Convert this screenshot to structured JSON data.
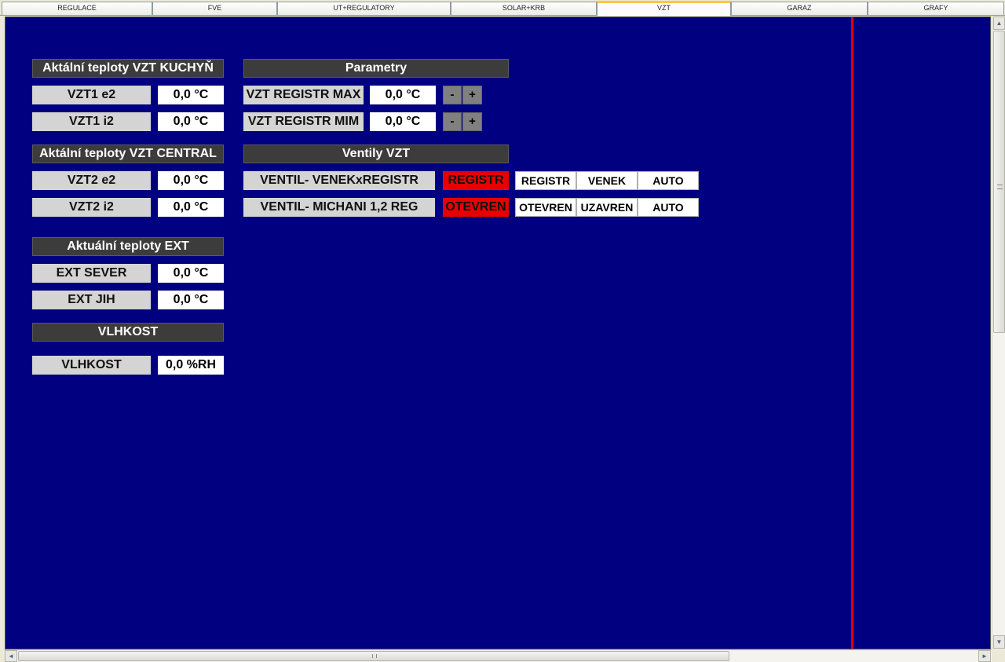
{
  "tabs": [
    {
      "label": "REGULACE"
    },
    {
      "label": "FVE"
    },
    {
      "label": "UT+REGULATORY"
    },
    {
      "label": "SOLAR+KRB"
    },
    {
      "label": "VZT"
    },
    {
      "label": "GARAZ"
    },
    {
      "label": "GRAFY"
    }
  ],
  "active_tab": "VZT",
  "kuchyn": {
    "title": "Aktální teploty VZT KUCHYŇ",
    "rows": [
      {
        "label": "VZT1 e2",
        "value": "0,0 °C"
      },
      {
        "label": "VZT1 i2",
        "value": "0,0 °C"
      }
    ]
  },
  "central": {
    "title": "Aktální teploty VZT CENTRAL",
    "rows": [
      {
        "label": "VZT2 e2",
        "value": "0,0 °C"
      },
      {
        "label": "VZT2 i2",
        "value": "0,0 °C"
      }
    ]
  },
  "ext": {
    "title": "Aktuální teploty EXT",
    "rows": [
      {
        "label": "EXT SEVER",
        "value": "0,0 °C"
      },
      {
        "label": "EXT JIH",
        "value": "0,0 °C"
      }
    ]
  },
  "vlhkost": {
    "title": "VLHKOST",
    "rows": [
      {
        "label": "VLHKOST",
        "value": "0,0 %RH"
      }
    ]
  },
  "parametry": {
    "title": "Parametry",
    "rows": [
      {
        "label": "VZT REGISTR MAX",
        "value": "0,0 °C",
        "minus": "-",
        "plus": "+"
      },
      {
        "label": "VZT REGISTR MIM",
        "value": "0,0 °C",
        "minus": "-",
        "plus": "+"
      }
    ]
  },
  "ventily": {
    "title": "Ventily VZT",
    "rows": [
      {
        "label": "VENTIL- VENEKxREGISTR",
        "status": "REGISTR",
        "options": [
          "REGISTR",
          "VENEK",
          "AUTO"
        ]
      },
      {
        "label": "VENTIL- MICHANI 1,2 REG",
        "status": "OTEVREN",
        "options": [
          "OTEVREN",
          "UZAVREN",
          "AUTO"
        ]
      }
    ]
  },
  "colors": {
    "background": "#000080",
    "header": "#3c3c3c",
    "label": "#d4d4d4",
    "status_active": "#e80000",
    "divider": "#e00000"
  },
  "scrollbars": {
    "up_icon": "▲",
    "down_icon": "▼",
    "left_icon": "◄",
    "right_icon": "►"
  }
}
